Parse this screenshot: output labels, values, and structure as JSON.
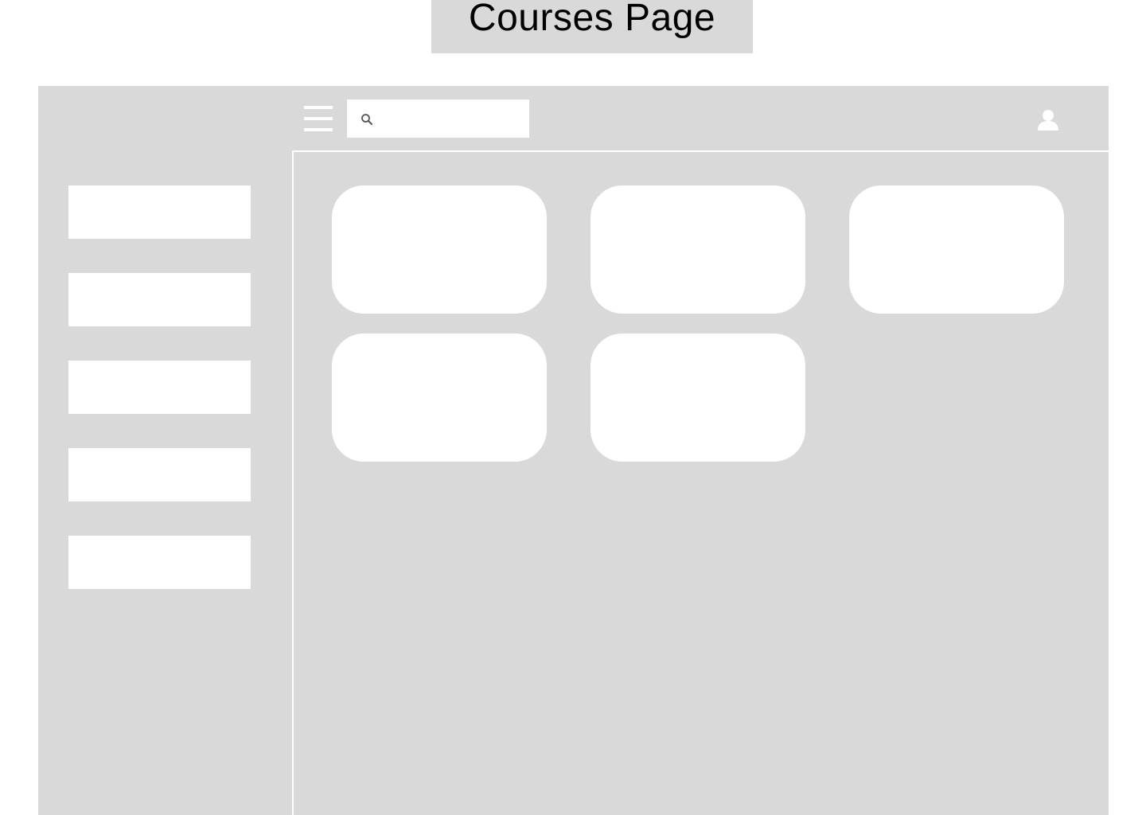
{
  "page": {
    "title": "Courses Page"
  },
  "search": {
    "placeholder": "",
    "value": ""
  },
  "sidebar": {
    "items": [
      {
        "label": ""
      },
      {
        "label": ""
      },
      {
        "label": ""
      },
      {
        "label": ""
      },
      {
        "label": ""
      }
    ]
  },
  "courses": {
    "cards": [
      {
        "title": ""
      },
      {
        "title": ""
      },
      {
        "title": ""
      },
      {
        "title": ""
      },
      {
        "title": ""
      }
    ]
  },
  "colors": {
    "frame": "#d9d9d9",
    "surface": "#ffffff",
    "icon": "#555555"
  },
  "icons": {
    "menu": "hamburger-menu",
    "search": "magnifier",
    "user": "user-avatar"
  }
}
